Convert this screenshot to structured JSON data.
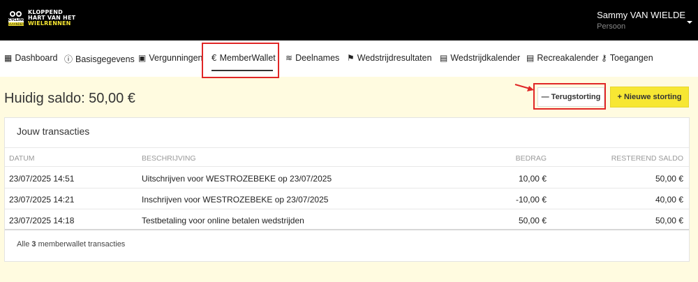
{
  "brand": {
    "logo_cycling": "CYCLING",
    "logo_vl": "VLAANDEREN",
    "line1": "KLOPPEND",
    "line2": "HART VAN HET",
    "line3": "WIELRENNEN"
  },
  "user": {
    "name": "Sammy VAN WIELDE",
    "role": "Persoon"
  },
  "nav": [
    {
      "label": "Dashboard",
      "icon": "grid-icon"
    },
    {
      "label": "Basisgegevens",
      "icon": "info-icon"
    },
    {
      "label": "Vergunningen",
      "icon": "id-card-icon"
    },
    {
      "label": "MemberWallet",
      "icon": "euro-icon"
    },
    {
      "label": "Deelnames",
      "icon": "layers-icon"
    },
    {
      "label": "Wedstrijdresultaten",
      "icon": "flag-icon"
    },
    {
      "label": "Wedstrijdkalender",
      "icon": "calendar-icon"
    },
    {
      "label": "Recreakalender",
      "icon": "calendar-icon"
    },
    {
      "label": "Toegangen",
      "icon": "key-icon"
    }
  ],
  "balance": "Huidig saldo: 50,00 €",
  "buttons": {
    "refund": "— Terugstorting",
    "new_deposit": "+ Nieuwe storting"
  },
  "card": {
    "title": "Jouw transacties",
    "columns": [
      "DATUM",
      "BESCHRIJVING",
      "BEDRAG",
      "RESTEREND SALDO"
    ],
    "rows": [
      {
        "date": "23/07/2025 14:51",
        "desc": "Uitschrijven voor WESTROZEBEKE op 23/07/2025",
        "amount": "10,00 €",
        "rest": "50,00 €"
      },
      {
        "date": "23/07/2025 14:21",
        "desc": "Inschrijven voor WESTROZEBEKE op 23/07/2025",
        "amount": "-10,00 €",
        "rest": "40,00 €"
      },
      {
        "date": "23/07/2025 14:18",
        "desc": "Testbetaling voor online betalen wedstrijden",
        "amount": "50,00 €",
        "rest": "50,00 €"
      }
    ],
    "footer_prefix": "Alle",
    "footer_count": "3",
    "footer_suffix": "memberwallet transacties"
  },
  "colors": {
    "accent": "#f7e733",
    "highlight": "#e02626",
    "background": "#fffbe0"
  }
}
